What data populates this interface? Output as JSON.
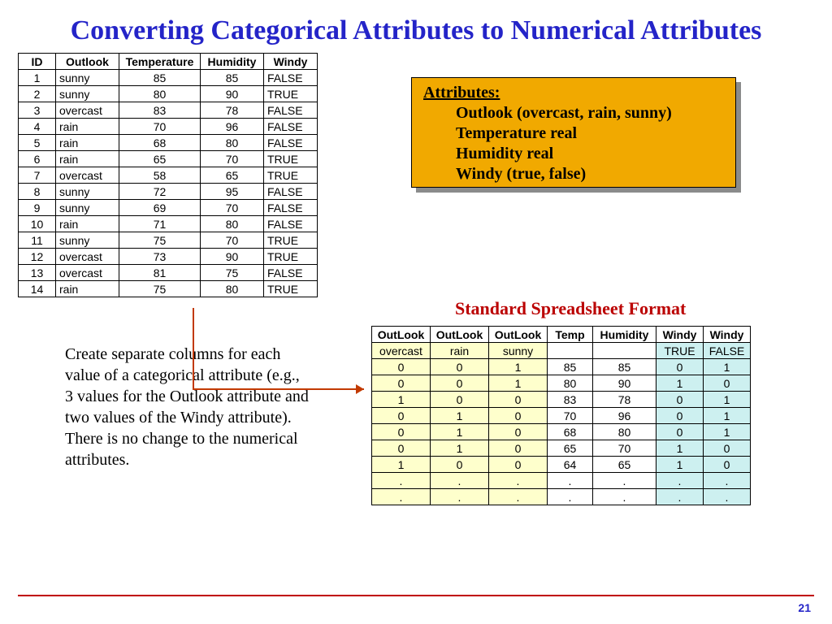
{
  "title": "Converting Categorical Attributes to Numerical Attributes",
  "table1": {
    "headers": [
      "ID",
      "Outlook",
      "Temperature",
      "Humidity",
      "Windy"
    ],
    "rows": [
      [
        "1",
        "sunny",
        "85",
        "85",
        "FALSE"
      ],
      [
        "2",
        "sunny",
        "80",
        "90",
        "TRUE"
      ],
      [
        "3",
        "overcast",
        "83",
        "78",
        "FALSE"
      ],
      [
        "4",
        "rain",
        "70",
        "96",
        "FALSE"
      ],
      [
        "5",
        "rain",
        "68",
        "80",
        "FALSE"
      ],
      [
        "6",
        "rain",
        "65",
        "70",
        "TRUE"
      ],
      [
        "7",
        "overcast",
        "58",
        "65",
        "TRUE"
      ],
      [
        "8",
        "sunny",
        "72",
        "95",
        "FALSE"
      ],
      [
        "9",
        "sunny",
        "69",
        "70",
        "FALSE"
      ],
      [
        "10",
        "rain",
        "71",
        "80",
        "FALSE"
      ],
      [
        "11",
        "sunny",
        "75",
        "70",
        "TRUE"
      ],
      [
        "12",
        "overcast",
        "73",
        "90",
        "TRUE"
      ],
      [
        "13",
        "overcast",
        "81",
        "75",
        "FALSE"
      ],
      [
        "14",
        "rain",
        "75",
        "80",
        "TRUE"
      ]
    ]
  },
  "attr_box": {
    "heading": "Attributes:",
    "lines": [
      "Outlook (overcast, rain, sunny)",
      "Temperature real",
      "Humidity real",
      "Windy (true, false)"
    ]
  },
  "ss_heading": "Standard Spreadsheet Format",
  "table2": {
    "headers": [
      "OutLook",
      "OutLook",
      "OutLook",
      "Temp",
      "Humidity",
      "Windy",
      "Windy"
    ],
    "subheaders": [
      "overcast",
      "rain",
      "sunny",
      "",
      "",
      "TRUE",
      "FALSE"
    ],
    "rows": [
      [
        "0",
        "0",
        "1",
        "85",
        "85",
        "0",
        "1"
      ],
      [
        "0",
        "0",
        "1",
        "80",
        "90",
        "1",
        "0"
      ],
      [
        "1",
        "0",
        "0",
        "83",
        "78",
        "0",
        "1"
      ],
      [
        "0",
        "1",
        "0",
        "70",
        "96",
        "0",
        "1"
      ],
      [
        "0",
        "1",
        "0",
        "68",
        "80",
        "0",
        "1"
      ],
      [
        "0",
        "1",
        "0",
        "65",
        "70",
        "1",
        "0"
      ],
      [
        "1",
        "0",
        "0",
        "64",
        "65",
        "1",
        "0"
      ],
      [
        ".",
        ".",
        ".",
        ".",
        ".",
        ".",
        "."
      ],
      [
        ".",
        ".",
        ".",
        ".",
        ".",
        ".",
        "."
      ]
    ]
  },
  "paragraph": "Create separate columns for each value of a categorical attribute (e.g., 3 values for the Outlook attribute and two values of the Windy attribute). There is no change to the numerical attributes.",
  "page_number": "21"
}
